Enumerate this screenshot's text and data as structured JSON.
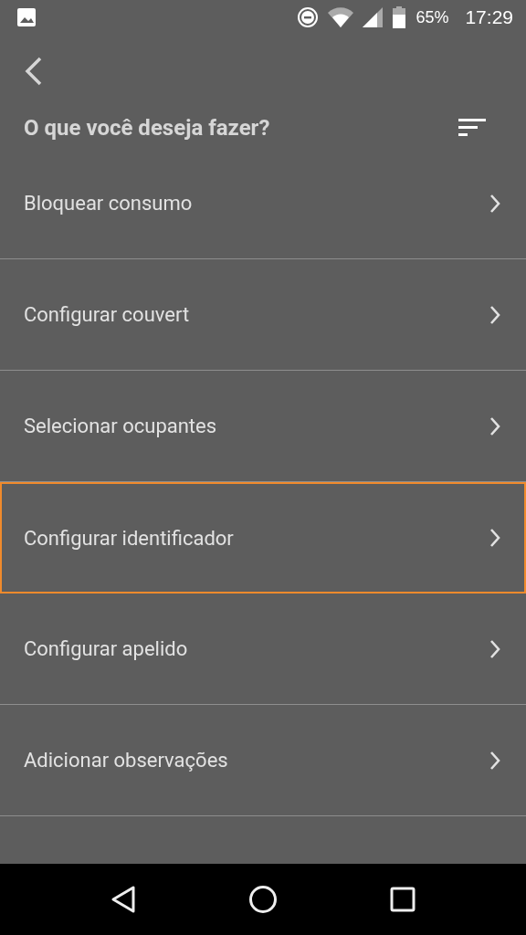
{
  "status_bar": {
    "battery": "65%",
    "time": "17:29"
  },
  "header": {
    "title": "O que você deseja fazer?"
  },
  "options": [
    {
      "label": "Bloquear consumo",
      "selected": false
    },
    {
      "label": "Configurar couvert",
      "selected": false
    },
    {
      "label": "Selecionar ocupantes",
      "selected": false
    },
    {
      "label": "Configurar identificador",
      "selected": true
    },
    {
      "label": "Configurar apelido",
      "selected": false
    },
    {
      "label": "Adicionar observações",
      "selected": false
    }
  ]
}
